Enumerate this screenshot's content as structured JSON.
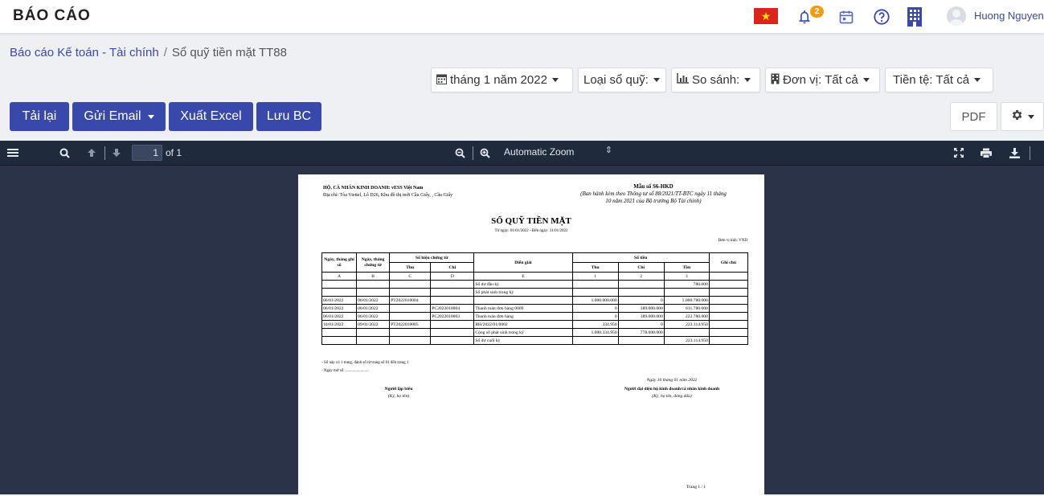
{
  "header": {
    "app_title": "BÁO CÁO",
    "notification_count": "2",
    "username": "Huong Nguyen"
  },
  "breadcrumb": {
    "parent": "Báo cáo Kế toán - Tài chính",
    "separator": "/",
    "current": "Sổ quỹ tiền mặt TT88"
  },
  "filters": {
    "period": "tháng 1 năm 2022",
    "ledger_type": "Loại sổ quỹ:",
    "compare": "So sánh:",
    "unit": "Đơn vị: Tất cả",
    "currency": "Tiền tệ: Tất cả"
  },
  "actions": {
    "reload": "Tải lại",
    "send_email": "Gửi Email",
    "export_excel": "Xuất Excel",
    "save_report": "Lưu BC",
    "pdf": "PDF"
  },
  "viewer": {
    "page_number": "1",
    "of_pages": "of 1",
    "zoom": "Automatic Zoom"
  },
  "document": {
    "business": "HỘ, CÁ NHÂN KINH DOANH: vESS Việt Nam",
    "address": "Địa chỉ: Tòa Viettel, Lô D26, Khu đô thị mới Cầu Giấy, , Cầu Giấy",
    "form_no": "Mẫu số S6-HKD",
    "form_note": "(Ban hành kèm theo Thông tư số 88/2021/TT-BTC ngày 11 tháng 10 năm 2021 của Bộ trưởng Bộ Tài chính)",
    "title": "SỔ QUỸ TIỀN MẶT",
    "date_range": "Từ ngày: 01/01/2022 - Đến ngày: 31/01/2022",
    "unit": "Đơn vị tính: VND",
    "headers": {
      "record_date": "Ngày, tháng ghi sổ",
      "doc_date": "Ngày, tháng chứng từ",
      "doc_no": "Số hiệu chứng từ",
      "receipt": "Thu",
      "payment": "Chi",
      "description": "Diễn giải",
      "amount": "Số tiền",
      "amount_in": "Thu",
      "amount_out": "Chi",
      "balance": "Tồn",
      "note": "Ghi chú"
    },
    "col_codes": [
      "A",
      "B",
      "C",
      "D",
      "E",
      "1",
      "2",
      "3",
      ""
    ],
    "rows": [
      [
        "",
        "",
        "",
        "",
        "Số dư đầu kỳ",
        "",
        "",
        "780.000",
        ""
      ],
      [
        "",
        "",
        "",
        "",
        "Số phát sinh trong kỳ",
        "",
        "",
        "",
        ""
      ],
      [
        "06/01/2022",
        "06/01/2022",
        "PT2022010004",
        "",
        "",
        "1.000.000.000",
        "0",
        "1.000.780.000",
        ""
      ],
      [
        "06/01/2022",
        "06/01/2022",
        "",
        "PC2022010004",
        "Thanh toán đơn hàng 0009",
        "0",
        "389.000.000",
        "611.780.000",
        ""
      ],
      [
        "06/01/2022",
        "06/01/2022",
        "",
        "PC2022010003",
        "Thanh toán đơn hàng",
        "0",
        "389.000.000",
        "222.780.000",
        ""
      ],
      [
        "10/01/2022",
        "09/01/2022",
        "PT2022010005",
        "",
        "BH/2022/01/0002",
        "334.950",
        "0",
        "223.114.950",
        ""
      ],
      [
        "",
        "",
        "",
        "",
        "Cộng số phát sinh trong kỳ",
        "1.000.334.950",
        "778.000.000",
        "",
        ""
      ],
      [
        "",
        "",
        "",
        "",
        "Số dư cuối kỳ",
        "",
        "",
        "223.114.950",
        ""
      ]
    ],
    "note1": "- Sổ này có 1 trang, đánh số từ trang số 01 đến trang 1",
    "note2": "- Ngày mở sổ: .......................",
    "sign_date": "Ngày 10 tháng 01 năm 2022",
    "preparer": "Người lập biểu",
    "preparer_note": "(Ký, họ tên)",
    "representative": "Người đại diện hộ kinh doanh/cá nhân kinh doanh",
    "representative_note": "(Ký, họ tên, đóng dấu)",
    "page_footer": "Trang 1 /   1"
  }
}
